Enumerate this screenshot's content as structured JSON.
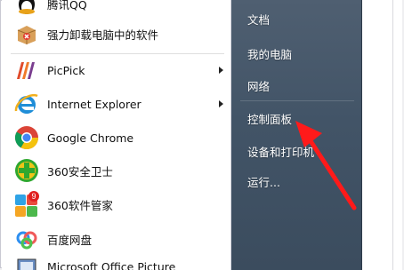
{
  "start_menu": {
    "left_items": [
      {
        "label": "腾讯QQ",
        "icon": "qq-penguin-icon",
        "has_submenu": false
      },
      {
        "label": "强力卸载电脑中的软件",
        "icon": "uninstall-box-icon",
        "has_submenu": false
      },
      {
        "label": "PicPick",
        "icon": "picpick-icon",
        "has_submenu": true
      },
      {
        "label": "Internet Explorer",
        "icon": "internet-explorer-icon",
        "has_submenu": true
      },
      {
        "label": "Google Chrome",
        "icon": "google-chrome-icon",
        "has_submenu": false
      },
      {
        "label": "360安全卫士",
        "icon": "360-safe-guard-icon",
        "has_submenu": false
      },
      {
        "label": "360软件管家",
        "icon": "360-software-manager-icon",
        "has_submenu": false
      },
      {
        "label": "百度网盘",
        "icon": "baidu-netdisk-icon",
        "has_submenu": false
      },
      {
        "label": "Microsoft Office Picture",
        "icon": "office-picture-manager-icon",
        "has_submenu": false
      }
    ],
    "right_items": [
      {
        "label": "文档"
      },
      {
        "label": "我的电脑"
      },
      {
        "label": "网络"
      },
      {
        "label": "控制面板"
      },
      {
        "label": "设备和打印机"
      },
      {
        "label": "运行..."
      }
    ],
    "badges": {
      "software_manager_badge": "9"
    }
  },
  "colors": {
    "right_pane": "#425467",
    "annotation_arrow": "#ff1a1a",
    "right_text": "#ffffff"
  }
}
